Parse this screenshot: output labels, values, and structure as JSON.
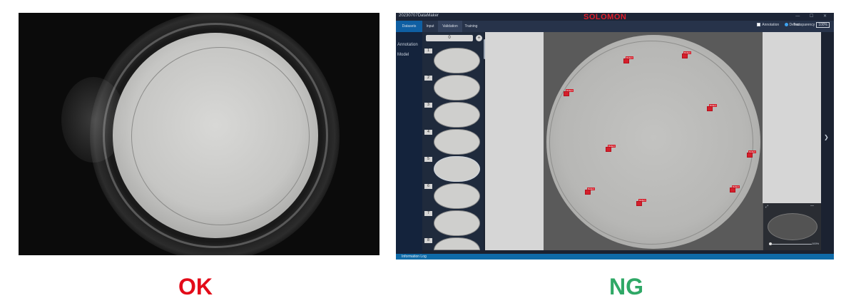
{
  "ok_panel": {
    "label": "OK",
    "label_color": "#e30b19"
  },
  "ng_panel": {
    "label": "NG",
    "label_color": "#2fa866"
  },
  "app": {
    "window_title": "20230707DataMaker",
    "brand": "SOLOMON",
    "brand_color": "#e11d2a",
    "window_controls": "— ☐ ✕",
    "tabs": [
      "Datasets",
      "Input",
      "Validation",
      "Training"
    ],
    "toolbar": {
      "annotation_label": "Annotation",
      "defect_label": "Defect",
      "transparency_label": "Transparency",
      "transparency_value": "100%"
    },
    "sidebar": [
      "Annotation",
      "Model"
    ],
    "annotation_input_value": "0",
    "add_button": "+",
    "thumbnails": [
      {
        "num": "1"
      },
      {
        "num": "2"
      },
      {
        "num": "3"
      },
      {
        "num": "4"
      },
      {
        "num": "5"
      },
      {
        "num": "6"
      },
      {
        "num": "7"
      },
      {
        "num": "8"
      }
    ],
    "defect_tag_text": "Defect",
    "defect_count": 10,
    "minimap_zoom": "100%",
    "info_log": "Information Log"
  }
}
